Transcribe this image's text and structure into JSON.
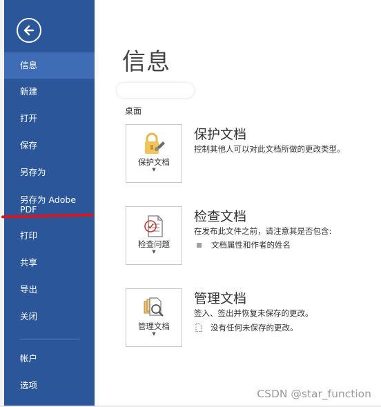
{
  "colors": {
    "sidebar_bg": "#2b579a",
    "sidebar_active": "#3e6db5",
    "red_annotation": "#d9161c"
  },
  "sidebar": {
    "back_icon": "back-arrow-icon",
    "items": [
      {
        "label": "信息",
        "active": true
      },
      {
        "label": "新建"
      },
      {
        "label": "打开"
      },
      {
        "label": "保存"
      },
      {
        "label": "另存为"
      },
      {
        "label": "另存为 Adobe PDF"
      },
      {
        "label": "打印"
      },
      {
        "label": "共享"
      },
      {
        "label": "导出"
      },
      {
        "label": "关闭"
      },
      {
        "label": "帐户"
      },
      {
        "label": "选项"
      }
    ]
  },
  "main": {
    "title": "信息",
    "location": "桌面",
    "sections": [
      {
        "card_label": "保护文档",
        "title": "保护文档",
        "desc": "控制其他人可以对此文档所做的更改类型。",
        "icon": "lock-icon"
      },
      {
        "card_label": "检查问题",
        "title": "检查文档",
        "desc": "在发布此文件之前，请注意其是否包含:",
        "bullet": "文档属性和作者的姓名",
        "icon": "inspect-document-icon"
      },
      {
        "card_label": "管理文档",
        "title": "管理文档",
        "desc": "签入、签出并恢复未保存的更改。",
        "bullet": "没有任何未保存的更改。",
        "icon": "manage-document-icon"
      }
    ]
  },
  "watermark": "CSDN @star_function"
}
